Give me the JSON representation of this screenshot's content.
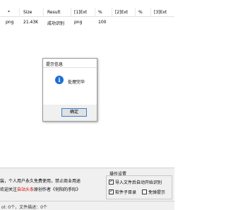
{
  "table": {
    "columns": [
      "*",
      "Size",
      "Result",
      "[1]Ext",
      "%",
      "[2]Ext",
      "%",
      "[3]Ext"
    ],
    "rows": [
      [
        "png",
        "21.43K",
        "成功识别",
        "png",
        "100",
        "",
        "",
        ""
      ]
    ]
  },
  "dialog": {
    "title": "提示信息",
    "message": "处理完毕",
    "ok_label": "确定",
    "icon": "info-icon"
  },
  "notice": {
    "line1": "装，个人用户永久免费使用，禁止商业用途",
    "line2_prefix": "欢迎关注",
    "line2_highlight": "自站头条",
    "line2_suffix": "原创作者《何阳的手际》"
  },
  "settings": {
    "title": "操作设置",
    "options": [
      {
        "label": "导入文件后自动开始识别",
        "checked": true
      },
      {
        "label": "软件子目录",
        "checked": true
      },
      {
        "label": "免弹提示",
        "checked": false
      }
    ]
  },
  "status": {
    "text": "ol: 0个，文件描述：0个"
  },
  "colors": {
    "highlight": "#d40000",
    "info_icon": "#1c6fd6"
  }
}
